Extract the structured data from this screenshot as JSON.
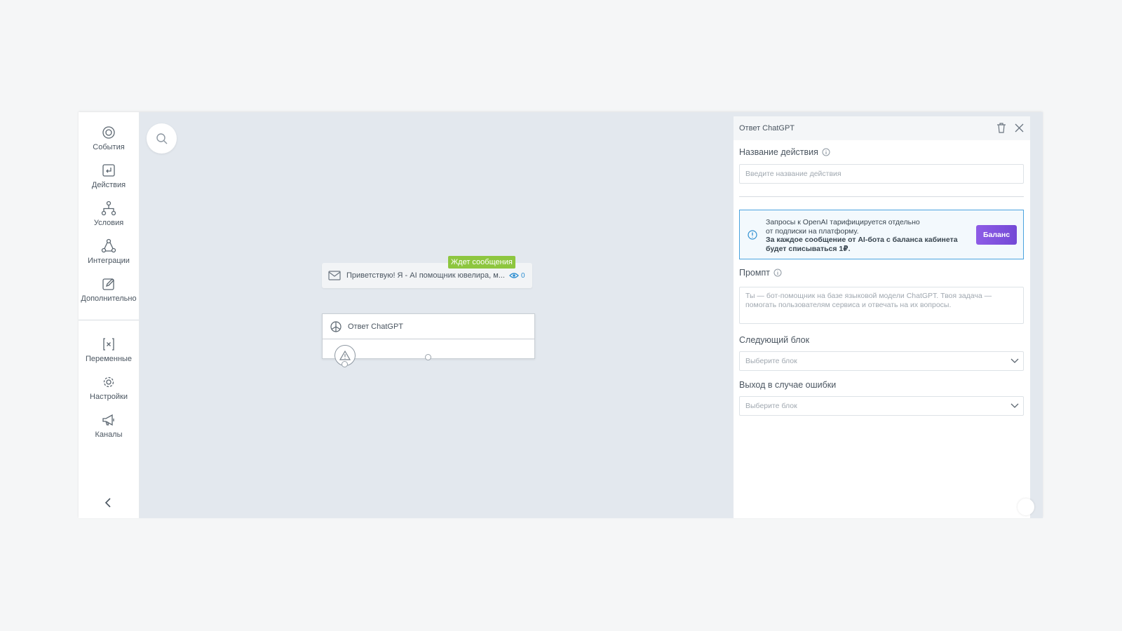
{
  "sidebar": {
    "items": [
      {
        "label": "События",
        "icon": "target-icon"
      },
      {
        "label": "Действия",
        "icon": "action-icon"
      },
      {
        "label": "Условия",
        "icon": "branch-icon"
      },
      {
        "label": "Интеграции",
        "icon": "integrations-icon"
      },
      {
        "label": "Дополнительно",
        "icon": "edit-icon"
      },
      {
        "label": "Переменные",
        "icon": "variable-icon"
      },
      {
        "label": "Настройки",
        "icon": "gear-icon"
      },
      {
        "label": "Каналы",
        "icon": "megaphone-icon"
      }
    ]
  },
  "canvas": {
    "message_node": {
      "text": "Приветствую! Я - AI помощник ювелира, м...",
      "views": "0",
      "badge": "Ждет сообщения"
    },
    "gpt_node": {
      "title": "Ответ ChatGPT"
    }
  },
  "panel": {
    "title": "Ответ ChatGPT",
    "action_name": {
      "label": "Название действия",
      "placeholder": "Введите название действия"
    },
    "info": {
      "line1": "Запросы к OpenAI тарифицируется отдельно",
      "line2": "от подписки на платформу.",
      "line3": "За каждое сообщение от AI-бота с баланса кабинета",
      "line4": "будет списываться 1₽.",
      "button": "Баланс"
    },
    "prompt": {
      "label": "Промпт",
      "placeholder_line1": "Ты — бот-помощник на базе языковой модели ChatGPT. Твоя задача —",
      "placeholder_line2": "помогать пользователям сервиса и отвечать на их вопросы."
    },
    "next_block": {
      "label": "Следующий блок",
      "placeholder": "Выберите блок"
    },
    "error_exit": {
      "label": "Выход в случае ошибки",
      "placeholder": "Выберите блок"
    }
  },
  "colors": {
    "badge": "#8dc63f",
    "accent_blue": "#2f8fd1",
    "balance_button": "#7f52de",
    "info_border": "#4aa3df",
    "canvas_bg": "#e3e8ee"
  }
}
